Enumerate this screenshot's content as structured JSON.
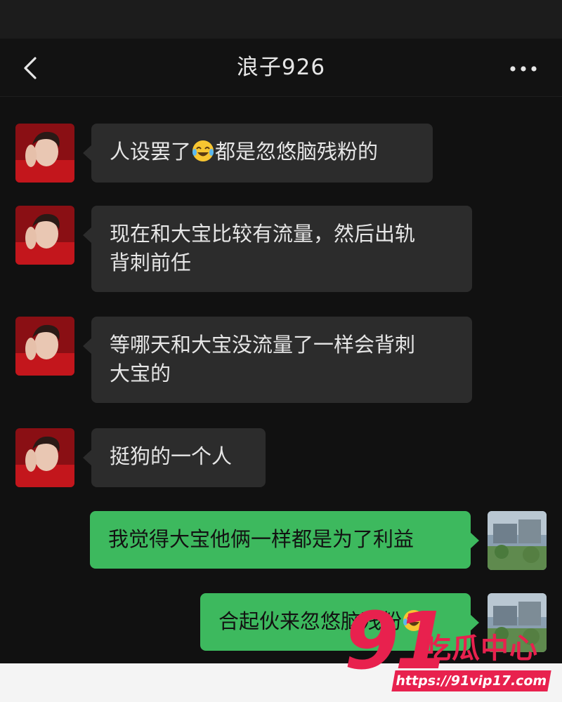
{
  "header": {
    "title": "浪子926"
  },
  "messages": [
    {
      "side": "in",
      "before": "人设罢了",
      "emoji": "face-with-tears-of-joy",
      "after": "都是忽悠脑残粉的"
    },
    {
      "side": "in",
      "line1": "现在和大宝比较有流量，然后出轨",
      "line2": "背刺前任"
    },
    {
      "side": "in",
      "line1": "等哪天和大宝没流量了一样会背刺",
      "line2": "大宝的"
    },
    {
      "side": "in",
      "text": "挺狗的一个人"
    },
    {
      "side": "out",
      "text": "我觉得大宝他俩一样都是为了利益"
    },
    {
      "side": "out",
      "before": "合起伙来忽悠脑残粉",
      "emoji": "face-with-tears-of-joy"
    }
  ],
  "watermark": {
    "number": "91",
    "name": "吃瓜中心",
    "url": "https://91vip17.com"
  },
  "colors": {
    "background": "#111111",
    "incoming_bubble": "#2c2c2c",
    "outgoing_bubble": "#3db95e",
    "watermark": "#e8214e"
  }
}
